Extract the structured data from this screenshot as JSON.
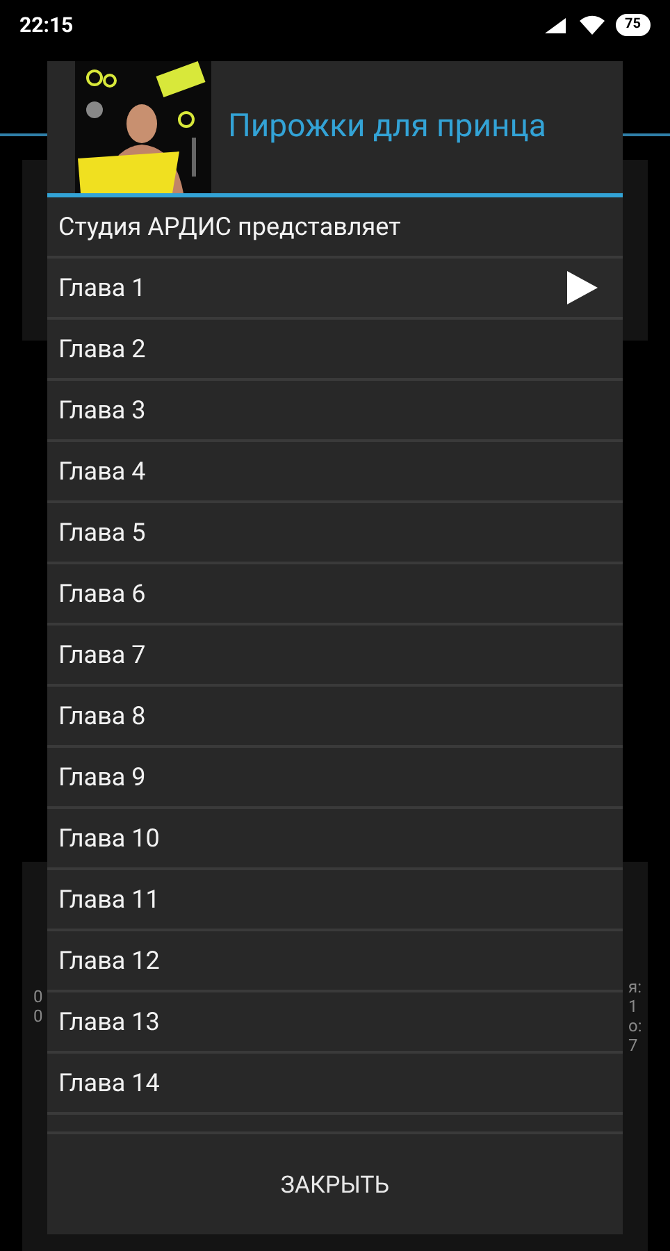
{
  "status_bar": {
    "time": "22:15",
    "battery": "75"
  },
  "background": {
    "left_fragments": [
      "0",
      "0"
    ],
    "right_fragments": [
      "я:",
      "1",
      "о:",
      "7"
    ]
  },
  "dialog": {
    "title": "Пирожки для принца",
    "items": [
      {
        "label": "Студия АРДИС представляет",
        "playing": false
      },
      {
        "label": "Глава 1",
        "playing": true
      },
      {
        "label": "Глава 2",
        "playing": false
      },
      {
        "label": "Глава 3",
        "playing": false
      },
      {
        "label": "Глава 4",
        "playing": false
      },
      {
        "label": "Глава 5",
        "playing": false
      },
      {
        "label": "Глава 6",
        "playing": false
      },
      {
        "label": "Глава 7",
        "playing": false
      },
      {
        "label": "Глава 8",
        "playing": false
      },
      {
        "label": "Глава 9",
        "playing": false
      },
      {
        "label": "Глава 10",
        "playing": false
      },
      {
        "label": "Глава 11",
        "playing": false
      },
      {
        "label": "Глава 12",
        "playing": false
      },
      {
        "label": "Глава 13",
        "playing": false
      },
      {
        "label": "Глава 14",
        "playing": false
      }
    ],
    "close_button": "ЗАКРЫТЬ"
  }
}
